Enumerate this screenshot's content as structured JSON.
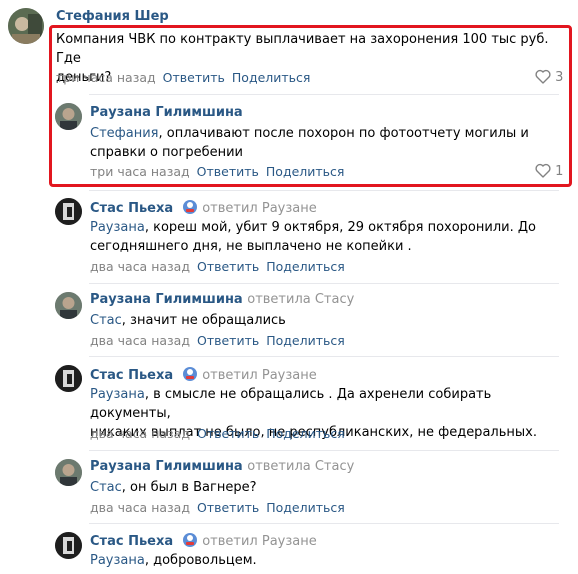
{
  "c1": {
    "author": "Стефания Шер",
    "text": "Компания ЧВК по контракту выплачивает на захоронения 100 тыс руб. Где деньги?",
    "text_line1": "Компания ЧВК по контракту выплачивает на захоронения 100 тыс руб. Где",
    "text_line2": "деньги?",
    "date": "три часа назад",
    "reply": "Ответить",
    "share": "Поделиться",
    "likes": "3"
  },
  "c2": {
    "author": "Раузана Гилимшина",
    "mention": "Стефания",
    "text_line1": ", оплачивают после похорон по фотоотчету могилы и",
    "text_line2": "справки о погребении",
    "date": "три часа назад",
    "reply": "Ответить",
    "share": "Поделиться",
    "likes": "1"
  },
  "c3": {
    "author": "Стас Пьеха",
    "replied": "ответил Раузане",
    "mention": "Раузана",
    "text_line1": ", кореш мой, убит 9 октября, 29 октября похоронили. До",
    "text_line2": "сегодняшнего дня, не выплачено не копейки .",
    "date": "два часа назад",
    "reply": "Ответить",
    "share": "Поделиться"
  },
  "c4": {
    "author": "Раузана Гилимшина",
    "replied": "ответила Стасу",
    "mention": "Стас",
    "text_line1": ", значит не обращались",
    "date": "два часа назад",
    "reply": "Ответить",
    "share": "Поделиться"
  },
  "c5": {
    "author": "Стас Пьеха",
    "replied": "ответил Раузане",
    "mention": "Раузана",
    "text_line1": ", в смысле не обращались . Да ахренели собирать документы,",
    "text_line2": "никаких выплат не было, не республиканских, не федеральных.",
    "date": "два часа назад",
    "reply": "Ответить",
    "share": "Поделиться"
  },
  "c6": {
    "author": "Раузана Гилимшина",
    "replied": "ответила Стасу",
    "mention": "Стас",
    "text_line1": ", он был в Вагнере?",
    "date": "два часа назад",
    "reply": "Ответить",
    "share": "Поделиться"
  },
  "c7": {
    "author": "Стас Пьеха",
    "replied": "ответил Раузане",
    "mention": "Раузана",
    "text_line1": ", добровольцем."
  },
  "colors": {
    "link": "#2a5885",
    "meta": "#828282",
    "highlight": "#e2161f"
  }
}
